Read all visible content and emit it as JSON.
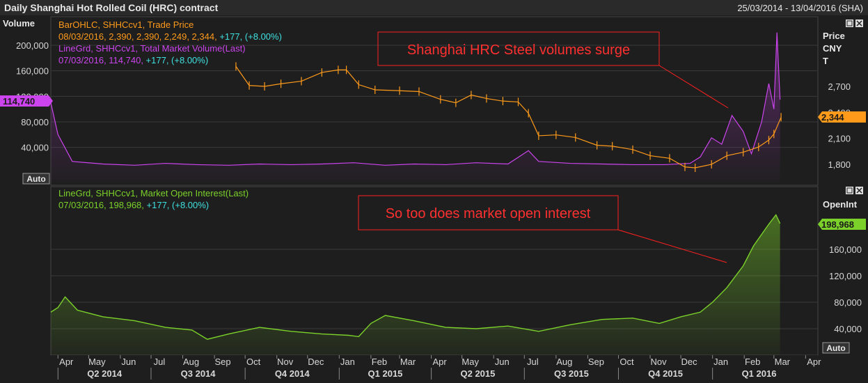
{
  "header": {
    "title": "Daily Shanghai Hot Rolled Coil (HRC) contract",
    "date_range": "25/03/2014 - 13/04/2016 (SHA)"
  },
  "colors": {
    "background": "#1e1e1e",
    "header_background": "#2a2a2a",
    "price": "#ff9a1a",
    "volume": "#cc44ee",
    "open_interest": "#7bd12a",
    "annotation": "#ff2020",
    "positive": "#3fe0e0",
    "grid": "#3a3a3a",
    "axis_text": "#d8d8d8"
  },
  "top_panel": {
    "volume_axis_title": "Volume",
    "price_axis_title_lines": [
      "Price",
      "CNY",
      "T"
    ],
    "auto_label": "Auto",
    "legend": [
      {
        "prefix": "BarOHLC, SHHCcv1, Trade Price",
        "color": "#ff9a1a"
      },
      {
        "prefix": "08/03/2016, 2,390, 2,390, 2,249, 2,344, ",
        "change": "+177, (+8.00%)",
        "color": "#ff9a1a"
      },
      {
        "prefix": "LineGrd, SHHCcv1, Total Market Volume(Last)",
        "color": "#cc44ee"
      },
      {
        "prefix": "07/03/2016, 114,740, ",
        "change": "+177, (+8.00%)",
        "color": "#cc44ee"
      }
    ],
    "volume_marker": "114,740",
    "price_marker": "2,344",
    "annotation": "Shanghai HRC Steel volumes surge"
  },
  "bottom_panel": {
    "oi_axis_title": "OpenInt",
    "auto_label": "Auto",
    "legend": [
      {
        "prefix": "LineGrd, SHHCcv1, Market Open Interest(Last)",
        "color": "#7bd12a"
      },
      {
        "prefix": "07/03/2016, 198,968, ",
        "change": "+177, (+8.00%)",
        "color": "#7bd12a"
      }
    ],
    "oi_marker": "198,968",
    "annotation": "So too does market open interest"
  },
  "chart_data": [
    {
      "type": "bar",
      "subtype": "ohlc",
      "series_name": "BarOHLC, SHHCcv1, Trade Price",
      "unit": "CNY/T",
      "x": [
        "2014-03-25",
        "2014-04-15",
        "2014-05-15",
        "2014-06-15",
        "2014-07-15",
        "2014-08-15",
        "2014-09-10",
        "2014-09-22",
        "2014-10-05",
        "2014-10-20",
        "2014-11-05",
        "2014-11-25",
        "2014-12-15",
        "2014-12-31",
        "2015-01-08",
        "2015-01-20",
        "2015-02-05",
        "2015-03-01",
        "2015-03-20",
        "2015-04-10",
        "2015-04-25",
        "2015-05-10",
        "2015-05-25",
        "2015-06-10",
        "2015-06-25",
        "2015-07-05",
        "2015-07-15",
        "2015-08-01",
        "2015-08-20",
        "2015-09-10",
        "2015-09-25",
        "2015-10-15",
        "2015-11-01",
        "2015-11-20",
        "2015-12-05",
        "2015-12-15",
        "2015-12-31",
        "2016-01-15",
        "2016-01-31",
        "2016-02-15",
        "2016-02-25",
        "2016-03-01",
        "2016-03-08"
      ],
      "y": [
        null,
        null,
        null,
        null,
        null,
        null,
        null,
        2930,
        2710,
        2700,
        2730,
        2760,
        2860,
        2890,
        2890,
        2720,
        2660,
        2650,
        2640,
        2550,
        2510,
        2600,
        2560,
        2530,
        2520,
        2390,
        2130,
        2140,
        2110,
        2020,
        2010,
        1970,
        1900,
        1870,
        1770,
        1760,
        1800,
        1900,
        1940,
        2000,
        2080,
        2150,
        2344
      ],
      "y_axis": {
        "ticks": [
          1800,
          2100,
          2400,
          2700
        ]
      }
    },
    {
      "type": "line",
      "series_name": "LineGrd, SHHCcv1, Total Market Volume(Last)",
      "x": [
        "2014-03-25",
        "2014-04-01",
        "2014-04-15",
        "2014-05-15",
        "2014-06-15",
        "2014-07-15",
        "2014-08-15",
        "2014-09-15",
        "2014-10-15",
        "2014-11-15",
        "2014-12-15",
        "2015-01-15",
        "2015-02-15",
        "2015-03-15",
        "2015-04-15",
        "2015-05-15",
        "2015-06-15",
        "2015-07-05",
        "2015-07-15",
        "2015-08-15",
        "2015-09-15",
        "2015-10-15",
        "2015-11-15",
        "2015-12-10",
        "2015-12-20",
        "2015-12-31",
        "2016-01-10",
        "2016-01-20",
        "2016-01-31",
        "2016-02-08",
        "2016-02-18",
        "2016-02-25",
        "2016-03-01",
        "2016-03-04",
        "2016-03-07"
      ],
      "y": [
        110000,
        60000,
        18000,
        14000,
        12000,
        15000,
        13000,
        12000,
        14000,
        13000,
        14000,
        16000,
        12000,
        14000,
        13000,
        16000,
        14000,
        35000,
        18000,
        15000,
        14000,
        13000,
        13000,
        15000,
        25000,
        55000,
        45000,
        90000,
        65000,
        30000,
        80000,
        140000,
        100000,
        220000,
        114740
      ],
      "y_axis": {
        "ticks": [
          40000,
          80000,
          120000,
          160000,
          200000
        ],
        "label": "Volume"
      }
    },
    {
      "type": "area",
      "series_name": "LineGrd, SHHCcv1, Market Open Interest(Last)",
      "x": [
        "2014-03-25",
        "2014-04-01",
        "2014-04-08",
        "2014-04-20",
        "2014-05-15",
        "2014-06-15",
        "2014-07-15",
        "2014-08-10",
        "2014-08-25",
        "2014-09-15",
        "2014-10-15",
        "2014-11-15",
        "2014-12-15",
        "2015-01-10",
        "2015-01-20",
        "2015-02-01",
        "2015-02-15",
        "2015-03-15",
        "2015-04-15",
        "2015-05-15",
        "2015-06-15",
        "2015-07-15",
        "2015-08-15",
        "2015-09-15",
        "2015-10-15",
        "2015-11-10",
        "2015-12-01",
        "2015-12-20",
        "2016-01-01",
        "2016-01-15",
        "2016-01-31",
        "2016-02-10",
        "2016-02-25",
        "2016-03-03",
        "2016-03-07"
      ],
      "y": [
        65000,
        72000,
        88000,
        68000,
        58000,
        52000,
        42000,
        38000,
        24000,
        32000,
        42000,
        36000,
        32000,
        30000,
        28000,
        48000,
        60000,
        52000,
        42000,
        40000,
        44000,
        36000,
        46000,
        54000,
        56000,
        48000,
        58000,
        65000,
        80000,
        102000,
        135000,
        165000,
        198000,
        212000,
        198968
      ],
      "y_axis": {
        "ticks": [
          40000,
          80000,
          120000,
          160000
        ],
        "label": "OpenInt"
      }
    }
  ],
  "x_axis": {
    "months": [
      "Apr",
      "May",
      "Jun",
      "Jul",
      "Aug",
      "Sep",
      "Oct",
      "Nov",
      "Dec",
      "Jan",
      "Feb",
      "Mar",
      "Apr",
      "May",
      "Jun",
      "Jul",
      "Aug",
      "Sep",
      "Oct",
      "Nov",
      "Dec",
      "Jan",
      "Feb",
      "Mar",
      "Apr"
    ],
    "quarters": [
      "Q2 2014",
      "Q3 2014",
      "Q4 2014",
      "Q1 2015",
      "Q2 2015",
      "Q3 2015",
      "Q4 2015",
      "Q1 2016"
    ]
  }
}
